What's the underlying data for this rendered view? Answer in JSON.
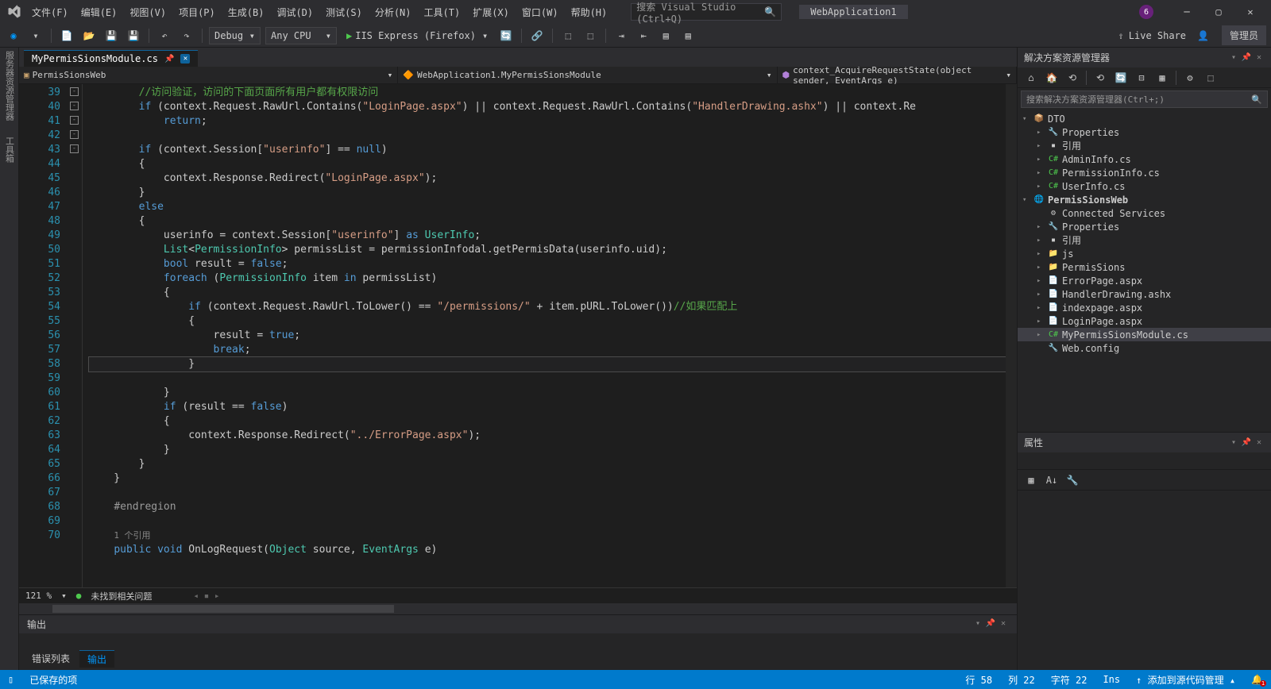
{
  "menu": [
    "文件(F)",
    "编辑(E)",
    "视图(V)",
    "项目(P)",
    "生成(B)",
    "调试(D)",
    "测试(S)",
    "分析(N)",
    "工具(T)",
    "扩展(X)",
    "窗口(W)",
    "帮助(H)"
  ],
  "search_placeholder": "搜索 Visual Studio (Ctrl+Q)",
  "app_title": "WebApplication1",
  "toolbar": {
    "config": "Debug",
    "platform": "Any CPU",
    "run": "IIS Express (Firefox)",
    "live": "Live Share",
    "admin": "管理员"
  },
  "tab": {
    "name": "MyPermisSionsModule.cs"
  },
  "nav": {
    "a": "PermisSionsWeb",
    "b": "WebApplication1.MyPermisSionsModule",
    "c": "context_AcquireRequestState(object sender, EventArgs e)"
  },
  "code": [
    {
      "n": 39,
      "f": "",
      "h": "        <span class='c-comment'>//访问验证，访问的下面页面所有用户都有权限访问</span>"
    },
    {
      "n": 40,
      "f": "",
      "h": "        <span class='c-key'>if</span> (context.Request.RawUrl.Contains(<span class='c-str'>\"LoginPage.aspx\"</span>) || context.Request.RawUrl.Contains(<span class='c-str'>\"HandlerDrawing.ashx\"</span>) || context.Re"
    },
    {
      "n": 41,
      "f": "",
      "h": "            <span class='c-key'>return</span>;"
    },
    {
      "n": 42,
      "f": "",
      "h": ""
    },
    {
      "n": 43,
      "f": "-",
      "h": "        <span class='c-key'>if</span> (context.Session[<span class='c-str'>\"userinfo\"</span>] == <span class='c-key'>null</span>)"
    },
    {
      "n": 44,
      "f": "",
      "h": "        {"
    },
    {
      "n": 45,
      "f": "",
      "h": "            context.Response.Redirect(<span class='c-str'>\"LoginPage.aspx\"</span>);"
    },
    {
      "n": 46,
      "f": "",
      "h": "        }"
    },
    {
      "n": 47,
      "f": "",
      "h": "        <span class='c-key'>else</span>"
    },
    {
      "n": 48,
      "f": "",
      "h": "        {"
    },
    {
      "n": 49,
      "f": "",
      "h": "            userinfo = context.Session[<span class='c-str'>\"userinfo\"</span>] <span class='c-key'>as</span> <span class='c-type'>UserInfo</span>;"
    },
    {
      "n": 50,
      "f": "",
      "h": "            <span class='c-type'>List</span>&lt;<span class='c-type'>PermissionInfo</span>&gt; permissList = permissionInfodal.getPermisData(userinfo.uid);"
    },
    {
      "n": 51,
      "f": "",
      "h": "            <span class='c-key'>bool</span> result = <span class='c-key'>false</span>;"
    },
    {
      "n": 52,
      "f": "-",
      "h": "            <span class='c-key'>foreach</span> (<span class='c-type'>PermissionInfo</span> item <span class='c-key'>in</span> permissList)"
    },
    {
      "n": 53,
      "f": "",
      "h": "            {"
    },
    {
      "n": 54,
      "f": "-",
      "h": "                <span class='c-key'>if</span> (context.Request.RawUrl.ToLower() == <span class='c-str'>\"/permissions/\"</span> + item.pURL.ToLower())<span class='c-comment'>//如果匹配上</span>"
    },
    {
      "n": 55,
      "f": "",
      "h": "                {"
    },
    {
      "n": 56,
      "f": "",
      "h": "                    result = <span class='c-key'>true</span>;"
    },
    {
      "n": 57,
      "f": "",
      "h": "                    <span class='c-key'>break</span>;"
    },
    {
      "n": 58,
      "f": "",
      "h": "                }",
      "cur": true
    },
    {
      "n": 59,
      "f": "",
      "h": ""
    },
    {
      "n": 60,
      "f": "",
      "h": "            }"
    },
    {
      "n": 61,
      "f": "-",
      "h": "            <span class='c-key'>if</span> (result == <span class='c-key'>false</span>)"
    },
    {
      "n": 62,
      "f": "",
      "h": "            {"
    },
    {
      "n": 63,
      "f": "",
      "h": "                context.Response.Redirect(<span class='c-str'>\"../ErrorPage.aspx\"</span>);"
    },
    {
      "n": 64,
      "f": "",
      "h": "            }"
    },
    {
      "n": 65,
      "f": "",
      "h": "        }"
    },
    {
      "n": 66,
      "f": "",
      "h": "    }"
    },
    {
      "n": 67,
      "f": "",
      "h": ""
    },
    {
      "n": 68,
      "f": "",
      "h": "    <span class='c-region'>#endregion</span>"
    },
    {
      "n": 69,
      "f": "",
      "h": ""
    },
    {
      "n": "",
      "f": "",
      "h": "    <span class='c-ref'>1 个引用</span>"
    },
    {
      "n": 70,
      "f": "-",
      "h": "    <span class='c-key'>public</span> <span class='c-key'>void</span> <span>OnLogRequest</span>(<span class='c-type'>Object</span> source, <span class='c-type'>EventArgs</span> e)"
    }
  ],
  "editor_status": {
    "zoom": "121 %",
    "issues": "未找到相关问题"
  },
  "solution": {
    "title": "解决方案资源管理器",
    "search": "搜索解决方案资源管理器(Ctrl+;)",
    "tree": [
      {
        "d": 0,
        "a": "▾",
        "i": "📦",
        "t": "DTO",
        "ic": "#c9a26d"
      },
      {
        "d": 1,
        "a": "▸",
        "i": "🔧",
        "t": "Properties",
        "ic": "#ccc"
      },
      {
        "d": 1,
        "a": "▸",
        "i": "▪",
        "t": "引用",
        "ic": "#ccc"
      },
      {
        "d": 1,
        "a": "▸",
        "i": "C#",
        "t": "AdminInfo.cs",
        "ic": "#4ec94e"
      },
      {
        "d": 1,
        "a": "▸",
        "i": "C#",
        "t": "PermissionInfo.cs",
        "ic": "#4ec94e"
      },
      {
        "d": 1,
        "a": "▸",
        "i": "C#",
        "t": "UserInfo.cs",
        "ic": "#4ec94e"
      },
      {
        "d": 0,
        "a": "▾",
        "i": "🌐",
        "t": "PermisSionsWeb",
        "b": true,
        "ic": "#4ec94e"
      },
      {
        "d": 1,
        "a": "",
        "i": "⚙",
        "t": "Connected Services",
        "ic": "#ccc"
      },
      {
        "d": 1,
        "a": "▸",
        "i": "🔧",
        "t": "Properties",
        "ic": "#ccc"
      },
      {
        "d": 1,
        "a": "▸",
        "i": "▪",
        "t": "引用",
        "ic": "#ccc"
      },
      {
        "d": 1,
        "a": "▸",
        "i": "📁",
        "t": "js",
        "ic": "#c9a26d"
      },
      {
        "d": 1,
        "a": "▸",
        "i": "📁",
        "t": "PermisSions",
        "ic": "#c9a26d"
      },
      {
        "d": 1,
        "a": "▸",
        "i": "📄",
        "t": "ErrorPage.aspx",
        "ic": "#6bb3ff"
      },
      {
        "d": 1,
        "a": "▸",
        "i": "📄",
        "t": "HandlerDrawing.ashx",
        "ic": "#6bb3ff"
      },
      {
        "d": 1,
        "a": "▸",
        "i": "📄",
        "t": "indexpage.aspx",
        "ic": "#6bb3ff"
      },
      {
        "d": 1,
        "a": "▸",
        "i": "📄",
        "t": "LoginPage.aspx",
        "ic": "#6bb3ff"
      },
      {
        "d": 1,
        "a": "▸",
        "i": "C#",
        "t": "MyPermisSionsModule.cs",
        "sel": true,
        "ic": "#4ec94e"
      },
      {
        "d": 1,
        "a": "",
        "i": "🔧",
        "t": "Web.config",
        "ic": "#ccc"
      }
    ]
  },
  "props_title": "属性",
  "output_title": "输出",
  "bottom_tabs": [
    "错误列表",
    "输出"
  ],
  "status": {
    "saved": "已保存的项",
    "line": "行 58",
    "col": "列 22",
    "char": "字符 22",
    "ins": "Ins",
    "src": "添加到源代码管理"
  }
}
